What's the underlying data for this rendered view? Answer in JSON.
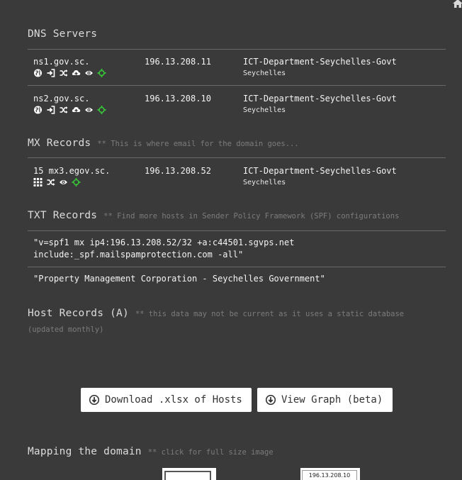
{
  "dns": {
    "title": "DNS Servers",
    "rows": [
      {
        "host": "ns1.gov.sc.",
        "ip": "196.13.208.11",
        "org": "ICT-Department-Seychelles-Govt",
        "country": "Seychelles"
      },
      {
        "host": "ns2.gov.sc.",
        "ip": "196.13.208.10",
        "org": "ICT-Department-Seychelles-Govt",
        "country": "Seychelles"
      }
    ]
  },
  "mx": {
    "title": "MX Records",
    "hint": "** This is where email for the domain goes...",
    "rows": [
      {
        "host": "15 mx3.egov.sc.",
        "ip": "196.13.208.52",
        "org": "ICT-Department-Seychelles-Govt",
        "country": "Seychelles"
      }
    ]
  },
  "txt": {
    "title": "TXT Records",
    "hint": "** Find more hosts in Sender Policy Framework (SPF) configurations",
    "records": [
      {
        "line1": "\"v=spf1 mx ip4:196.13.208.52/32 +a:c44501.sgvps.net",
        "line2": "include:_spf.mailspamprotection.com -all\""
      },
      {
        "line1": "\"Property Management Corporation - Seychelles Government\"",
        "line2": ""
      }
    ]
  },
  "host_records": {
    "title": "Host Records (A)",
    "hint_a": "** this data may not be current as it uses a static database",
    "hint_b": "(updated monthly)"
  },
  "buttons": {
    "download": "Download .xlsx of Hosts",
    "graph": "View Graph (beta)"
  },
  "mapping": {
    "title": "Mapping the domain",
    "hint": "** click for full size image",
    "thumb_label": "196.13.208.10"
  },
  "colors": {
    "background": "#3a3a3a",
    "accent_green": "#37c837",
    "rule": "#686868",
    "hint": "#7c7c7c"
  },
  "icons": [
    "home-icon",
    "globe-icon",
    "login-icon",
    "shuffle-icon",
    "cloud-upload-icon",
    "eye-icon",
    "crosshair-icon",
    "grid-icon",
    "download-circle-icon"
  ]
}
